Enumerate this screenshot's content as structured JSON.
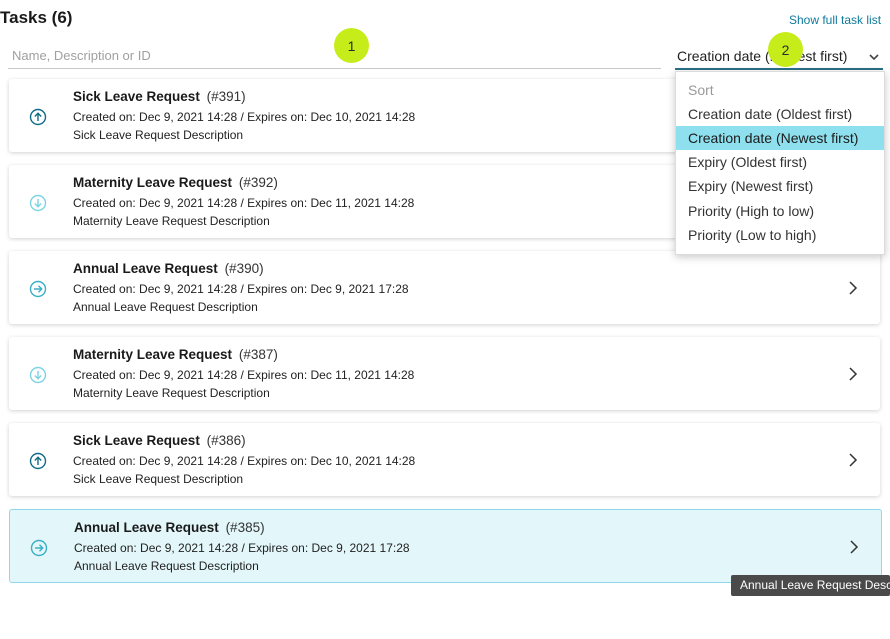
{
  "header": {
    "title": "Tasks (6)",
    "show_full_link": "Show full task list"
  },
  "search": {
    "placeholder": "Name, Description or ID"
  },
  "sort": {
    "value": "Creation date (Newest first)",
    "options_header": "Sort",
    "options": [
      "Creation date (Oldest first)",
      "Creation date (Newest first)",
      "Expiry (Oldest first)",
      "Expiry (Newest first)",
      "Priority (High to low)",
      "Priority (Low to high)"
    ],
    "selected_option": "Creation date (Newest first)"
  },
  "badges": [
    "1",
    "2"
  ],
  "tasks": [
    {
      "name": "Sick Leave Request",
      "id": "(#391)",
      "dates": "Created on: Dec 9, 2021 14:28 / Expires on: Dec 10, 2021 14:28",
      "description": "Sick Leave Request Description",
      "priority_icon": "arrow-up-circle-icon"
    },
    {
      "name": "Maternity Leave Request",
      "id": "(#392)",
      "dates": "Created on: Dec 9, 2021 14:28 / Expires on: Dec 11, 2021 14:28",
      "description": "Maternity Leave Request Description",
      "priority_icon": "arrow-down-circle-icon"
    },
    {
      "name": "Annual Leave Request",
      "id": "(#390)",
      "dates": "Created on: Dec 9, 2021 14:28 / Expires on: Dec 9, 2021 17:28",
      "description": "Annual Leave Request Description",
      "priority_icon": "arrow-right-circle-icon"
    },
    {
      "name": "Maternity Leave Request",
      "id": "(#387)",
      "dates": "Created on: Dec 9, 2021 14:28 / Expires on: Dec 11, 2021 14:28",
      "description": "Maternity Leave Request Description",
      "priority_icon": "arrow-down-circle-icon"
    },
    {
      "name": "Sick Leave Request",
      "id": "(#386)",
      "dates": "Created on: Dec 9, 2021 14:28 / Expires on: Dec 10, 2021 14:28",
      "description": "Sick Leave Request Description",
      "priority_icon": "arrow-up-circle-icon"
    },
    {
      "name": "Annual Leave Request",
      "id": "(#385)",
      "dates": "Created on: Dec 9, 2021 14:28 / Expires on: Dec 9, 2021 17:28",
      "description": "Annual Leave Request Description",
      "priority_icon": "arrow-right-circle-icon"
    }
  ],
  "tooltip": {
    "text": "Annual Leave Request Description"
  },
  "colors": {
    "accent": "#0f7a9c",
    "badge": "#c6ec1a",
    "selected_row": "#e3f7fb",
    "active_option": "#8fe0ee",
    "icon_up": "#126b86",
    "icon_light": "#7dd3e3"
  }
}
